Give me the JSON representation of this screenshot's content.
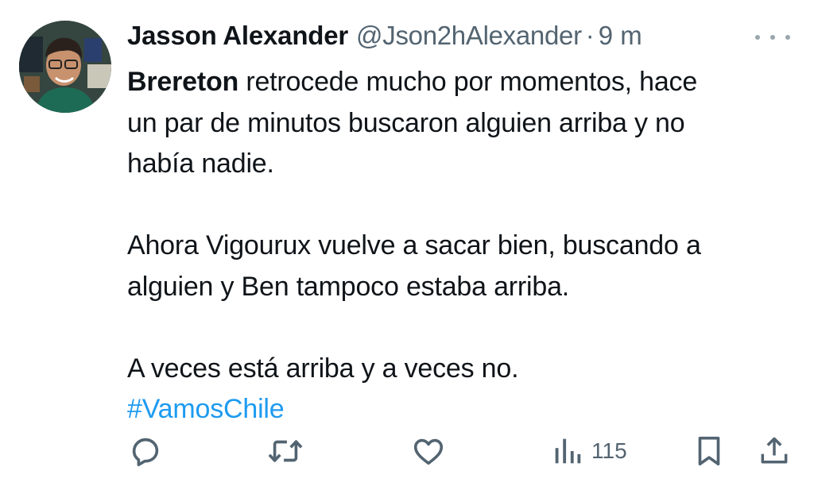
{
  "author": {
    "name": "Jasson Alexander",
    "handle": "@Json2hAlexander",
    "separator": "·",
    "time": "9 m"
  },
  "tweet": {
    "line1_bold": "Brereton",
    "line1_rest": " retrocede mucho por momentos, hace",
    "line2": "un par de minutos buscaron alguien arriba y no",
    "line3": "había nadie.",
    "line4": "Ahora Vigourux vuelve a sacar bien, buscando a",
    "line5": "alguien y Ben tampoco estaba arriba.",
    "line6": "A veces está arriba y a veces no.",
    "hashtag": "#VamosChile"
  },
  "actions": {
    "views": "115",
    "icons": [
      "reply-icon",
      "retweet-icon",
      "like-icon",
      "views-icon",
      "bookmark-icon",
      "share-icon"
    ]
  },
  "colors": {
    "text": "#0f1419",
    "secondary": "#536471",
    "link": "#1d9bf0"
  }
}
